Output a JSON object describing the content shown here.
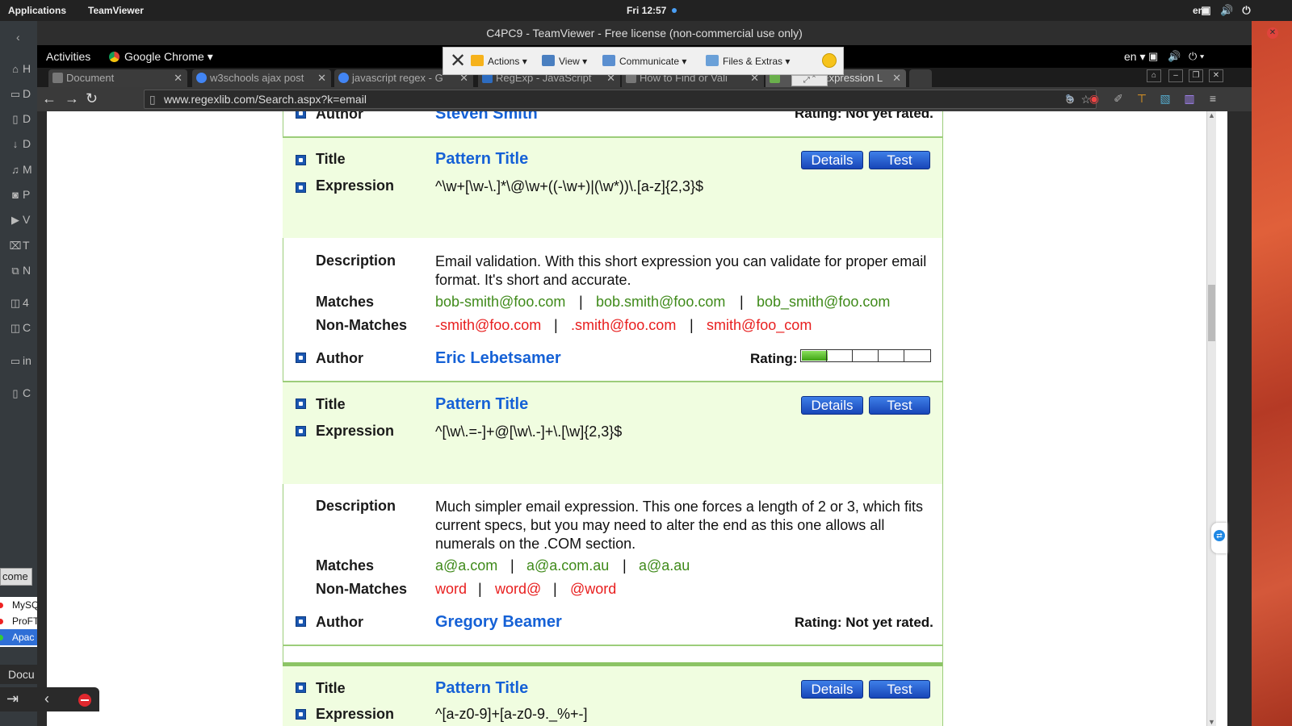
{
  "outer_bar": {
    "applications": "Applications",
    "app": "TeamViewer",
    "clock": "Fri 12:57",
    "lang": "en"
  },
  "dock": {
    "items": [
      "H",
      "D",
      "D",
      "D",
      "M",
      "P",
      "V",
      "T",
      "N",
      "4",
      "C",
      "in",
      "C"
    ]
  },
  "teamviewer": {
    "title": "C4PC9 - TeamViewer - Free license (non-commercial use only)",
    "panel": {
      "actions": "Actions",
      "view": "View",
      "communicate": "Communicate",
      "files": "Files & Extras"
    }
  },
  "remote_bar": {
    "activities": "Activities",
    "app": "Google Chrome",
    "lang": "en"
  },
  "tabs": [
    "Document",
    "w3schools ajax post",
    "javascript regex - G",
    "RegExp - JavaScript",
    "How to Find or Vali",
    "Expression L"
  ],
  "address": {
    "url": "www.regexlib.com/Search.aspx?k=email"
  },
  "colors": {
    "accent_link": "#1561d6",
    "match": "#3f8a1a",
    "non_match": "#e81e1e",
    "band": "#f0fde0"
  },
  "labels": {
    "title": "Title",
    "expression": "Expression",
    "description": "Description",
    "matches": "Matches",
    "non_matches": "Non-Matches",
    "author": "Author",
    "rating": "Rating:",
    "details": "Details",
    "test": "Test"
  },
  "prev_entry": {
    "author": "Steven Smith",
    "rating": "Rating: Not yet rated."
  },
  "entry1": {
    "title": "Pattern Title",
    "expression": "^\\w+[\\w-\\.]*\\@\\w+((-\\w+)|(\\w*))\\.[a-z]{2,3}$",
    "description": "Email validation. With this short expression you can validate for proper email format. It's short and accurate.",
    "matches": [
      "bob-smith@foo.com",
      "bob.smith@foo.com",
      "bob_smith@foo.com"
    ],
    "non_matches": [
      "-smith@foo.com",
      ".smith@foo.com",
      "smith@foo_com"
    ],
    "author": "Eric Lebetsamer",
    "rating_fraction": 0.2
  },
  "entry2": {
    "title": "Pattern Title",
    "expression": "^[\\w\\.=-]+@[\\w\\.-]+\\.[\\w]{2,3}$",
    "description": "Much simpler email expression. This one forces a length of 2 or 3, which fits current specs, but you may need to alter the end as this one allows all numerals on the .COM section.",
    "matches": [
      "a@a.com",
      "a@a.com.au",
      "a@a.au"
    ],
    "non_matches": [
      "word",
      "word@",
      "@word"
    ],
    "author": "Gregory Beamer",
    "rating": "Rating: Not yet rated."
  },
  "entry3": {
    "title": "Pattern Title",
    "expression_partial": "^[a-z0-9]+[a-z0-9._%+-]"
  },
  "bottom_left": {
    "tab": "come",
    "list": [
      "MySQ",
      "ProFT",
      "Apac"
    ],
    "doc": "Docu"
  }
}
